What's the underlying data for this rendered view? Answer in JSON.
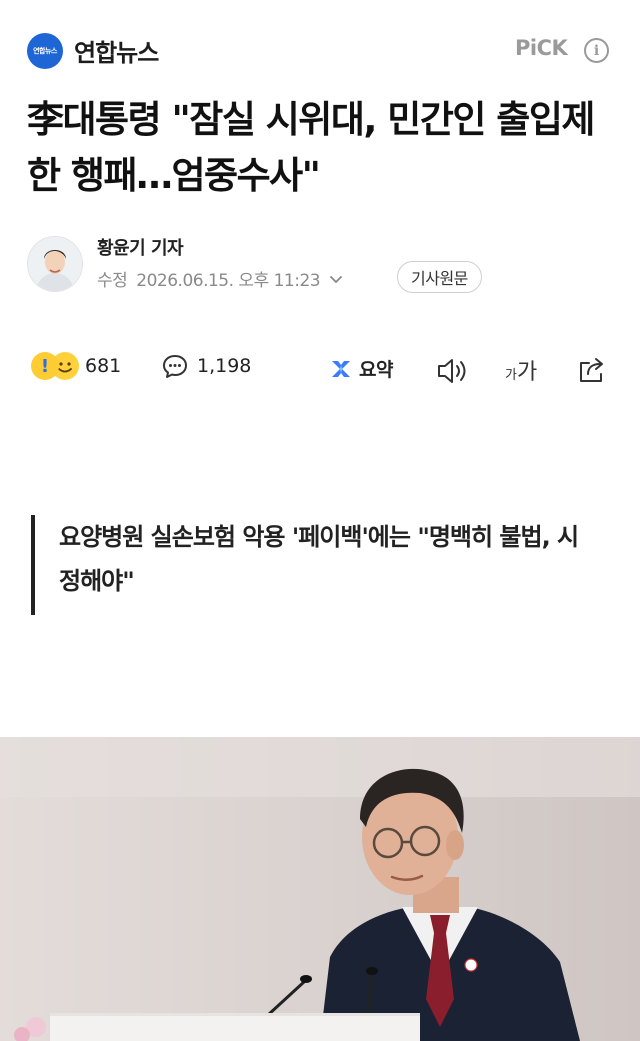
{
  "header": {
    "brand_logo_text": "연합뉴스",
    "brand_name": "연합뉴스",
    "pick_label": "PiCK",
    "info_symbol": "i",
    "brand_color": "#1e66d6"
  },
  "article": {
    "headline": "李대통령 \"잠실 시위대, 민간인 출입제한 행패…엄중수사\"",
    "reporter": "황윤기 기자",
    "meta_label": "수정",
    "timestamp": "2026.06.15. 오후 11:23",
    "original_button": "기사원문",
    "subheading": "요양병원 실손보험 악용 '페이백'에는 \"명백히 불법, 시정해야\""
  },
  "actions": {
    "reaction_count": "681",
    "comment_count": "1,198",
    "summary_label": "요약",
    "font_small": "가",
    "font_large": "가",
    "icons": [
      "reaction-emoji-icon",
      "comment-bubble-icon",
      "ai-summary-icon",
      "speaker-icon",
      "font-size-icon",
      "share-icon"
    ]
  }
}
